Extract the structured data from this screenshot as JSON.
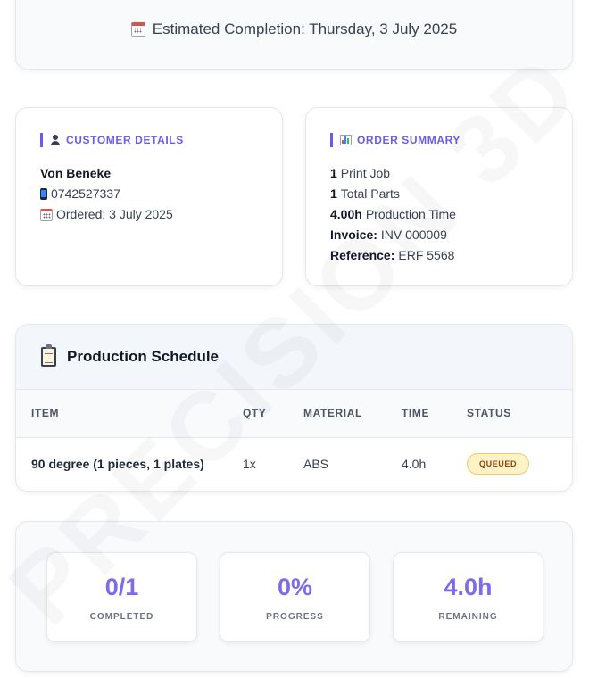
{
  "banner": {
    "icon": "calendar-icon",
    "text": "Estimated Completion: Thursday, 3 July 2025"
  },
  "watermark": "PRECISION 3D",
  "customer": {
    "heading": "CUSTOMER DETAILS",
    "icon": "person-icon",
    "name": "Von Beneke",
    "phone": "0742527337",
    "ordered": "Ordered: 3 July 2025"
  },
  "order": {
    "heading": "ORDER SUMMARY",
    "icon": "bar-chart-icon",
    "print_jobs_count": "1",
    "print_jobs_label": "Print Job",
    "parts_count": "1",
    "parts_label": "Total Parts",
    "production_time": "4.00h",
    "production_time_label": "Production Time",
    "invoice_label": "Invoice:",
    "invoice_value": "INV 000009",
    "reference_label": "Reference:",
    "reference_value": "ERF 5568"
  },
  "schedule": {
    "icon": "clipboard-icon",
    "title": "Production Schedule",
    "columns": [
      "ITEM",
      "QTY",
      "MATERIAL",
      "TIME",
      "STATUS"
    ],
    "rows": [
      {
        "item": "90 degree (1 pieces, 1 plates)",
        "qty": "1x",
        "material": "ABS",
        "time": "4.0h",
        "status": "QUEUED"
      }
    ]
  },
  "stats": [
    {
      "value": "0/1",
      "label": "COMPLETED"
    },
    {
      "value": "0%",
      "label": "PROGRESS"
    },
    {
      "value": "4.0h",
      "label": "REMAINING"
    }
  ],
  "colors": {
    "accent": "#6b5ce7",
    "stat_value": "#7c6ce8",
    "status_queued_bg": "#fef3c7",
    "status_queued_text": "#92400e"
  }
}
